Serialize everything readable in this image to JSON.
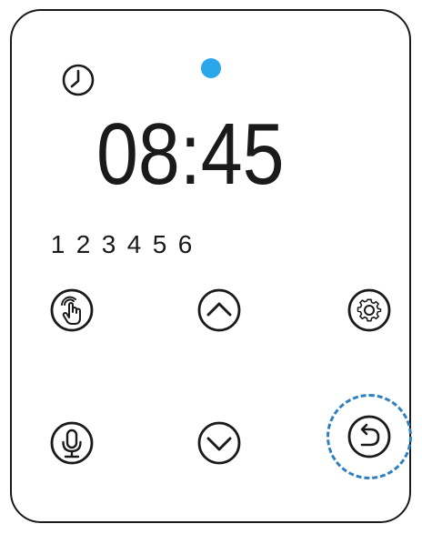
{
  "screen": {
    "time": "08:45",
    "channels": [
      "1",
      "2",
      "3",
      "4",
      "5",
      "6"
    ],
    "indicator_color": "#2aa7ea",
    "highlight_color": "#2f7fc1"
  },
  "icons": {
    "status": "clock-icon",
    "touch": "hand-touch-icon",
    "up": "chevron-up-icon",
    "settings": "gear-icon",
    "mic": "microphone-icon",
    "down": "chevron-down-icon",
    "back": "undo-icon"
  }
}
